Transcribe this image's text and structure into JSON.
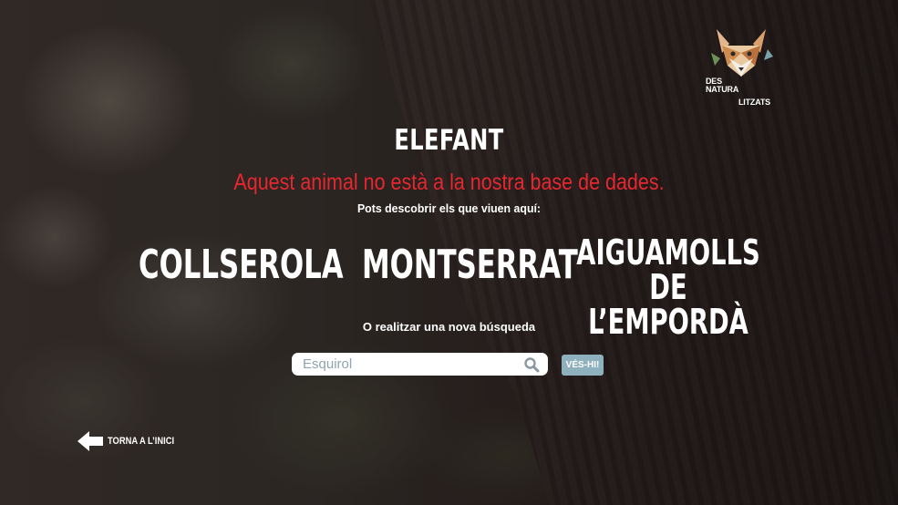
{
  "logo": {
    "line1": "DES",
    "line2": "NATURA",
    "line3": "LITZATS",
    "icon": "fox-icon"
  },
  "result": {
    "animal": "ELEFANT",
    "message": "Aquest animal no està a la nostra base de dades.",
    "discover_prompt": "Pots descobrir els que viuen aquí:"
  },
  "places": [
    {
      "label": "COLLSEROLA"
    },
    {
      "label": "MONTSERRAT"
    },
    {
      "label_line1": "AIGUAMOLLS",
      "label_line2": "DE L’EMPORDÀ"
    }
  ],
  "search": {
    "prompt": "O realitzar una nova búsqueda",
    "placeholder": "Esquirol",
    "button_label": "VÉS-HI!",
    "icon": "search-icon"
  },
  "navigation": {
    "back_label": "TORNA A L’INICI",
    "back_icon": "arrow-left-icon"
  },
  "colors": {
    "error": "#e8262f",
    "button": "#8fb1bd",
    "text": "#ffffff"
  }
}
